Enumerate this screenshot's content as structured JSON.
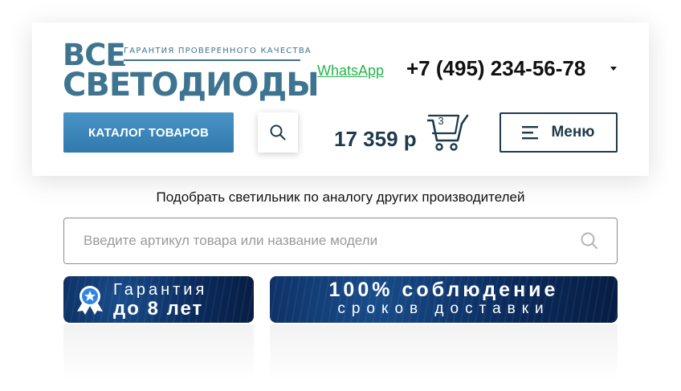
{
  "brand": {
    "logo_top": "ВСЕ",
    "logo_main": "СВЕТОДИОДЫ",
    "tagline": "ГАРАНТИЯ ПРОВЕРЕННОГО КАЧЕСТВА",
    "color": "#3f7490"
  },
  "contacts": {
    "whatsapp": "WhatsApp",
    "phone": "+7 (495) 234-56-78"
  },
  "nav": {
    "catalog_label": "КАТАЛОГ ТОВАРОВ",
    "menu_label": "Меню"
  },
  "cart": {
    "total": "17 359 р",
    "count": "3"
  },
  "analog_search": {
    "title": "Подобрать светильник по аналогу других производителей",
    "placeholder": "Введите артикул товара или название модели"
  },
  "banners": {
    "warranty": {
      "line1": "Гарантия",
      "line2": "до 8 лет"
    },
    "delivery": {
      "line1": "100% соблюдение",
      "line2": "сроков доставки"
    }
  },
  "icons": [
    "search-icon",
    "cart-icon",
    "hamburger-icon",
    "chevron-down-icon",
    "medal-icon"
  ],
  "colors": {
    "accent": "#3079ac",
    "dark": "#1e3a4c",
    "whatsapp": "#27b44c"
  }
}
